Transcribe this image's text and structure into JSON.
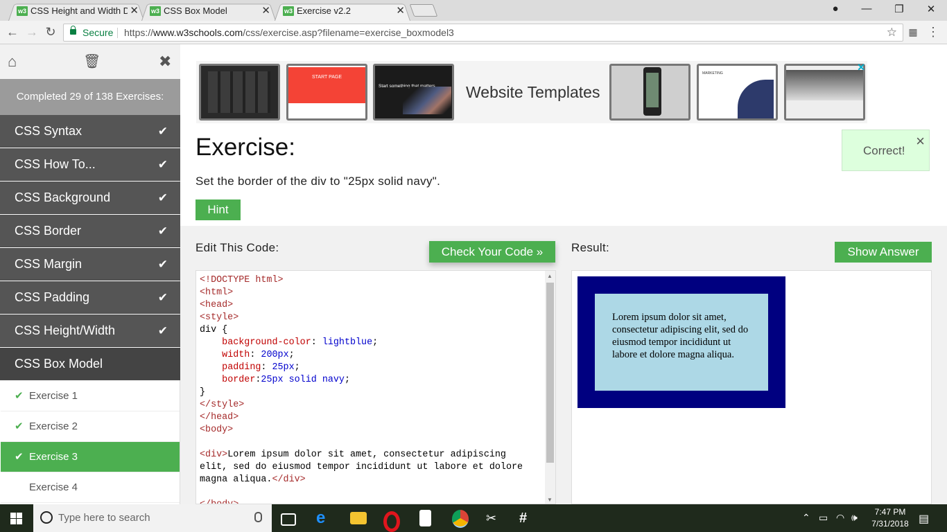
{
  "browser": {
    "tabs": [
      {
        "title": "CSS Height and Width Di",
        "active": false
      },
      {
        "title": "CSS Box Model",
        "active": false
      },
      {
        "title": "Exercise v2.2",
        "active": true
      }
    ],
    "secure_label": "Secure",
    "url_prefix": "https://",
    "url_host": "www.w3schools.com",
    "url_path": "/css/exercise.asp?filename=exercise_boxmodel3"
  },
  "sidebar": {
    "progress_text": "Completed 29 of 138 Exercises:",
    "chapters": [
      {
        "label": "CSS Syntax",
        "done": true
      },
      {
        "label": "CSS How To...",
        "done": true
      },
      {
        "label": "CSS Background",
        "done": true
      },
      {
        "label": "CSS Border",
        "done": true
      },
      {
        "label": "CSS Margin",
        "done": true
      },
      {
        "label": "CSS Padding",
        "done": true
      },
      {
        "label": "CSS Height/Width",
        "done": true
      },
      {
        "label": "CSS Box Model",
        "done": false
      }
    ],
    "exercises": [
      {
        "label": "Exercise 1",
        "done": true
      },
      {
        "label": "Exercise 2",
        "done": true
      },
      {
        "label": "Exercise 3",
        "done": true,
        "active": true
      },
      {
        "label": "Exercise 4",
        "done": false
      }
    ]
  },
  "ad": {
    "text": "Website Templates",
    "thumbs": [
      "dark-cafe",
      "start-page",
      "dark-gradient",
      "phone-hand",
      "marketing",
      "ocean-team"
    ],
    "thumb_start_page_label": "START PAGE",
    "thumb_dark_label": "Start something that matters",
    "thumb_marketing_label": "MARKETING"
  },
  "exercise": {
    "title": "Exercise:",
    "instruction": "Set the border of the div to \"25px solid navy\".",
    "hint_label": "Hint",
    "correct_label": "Correct!",
    "edit_label": "Edit This Code:",
    "check_label": "Check Your Code »",
    "result_label": "Result:",
    "show_answer_label": "Show Answer",
    "code_lines": [
      "<!DOCTYPE html>",
      "<html>",
      "<head>",
      "<style>",
      "div {",
      "    background-color: lightblue;",
      "    width: 200px;",
      "    padding: 25px;",
      "    border:25px solid navy;",
      "}",
      "</style>",
      "</head>",
      "<body>",
      "",
      "<div>Lorem ipsum dolor sit amet, consectetur adipiscing",
      "elit, sed do eiusmod tempor incididunt ut labore et dolore",
      "magna aliqua.</div>",
      "",
      "</body>"
    ],
    "result_text": "Lorem ipsum dolor sit amet, consectetur adipiscing elit, sed do eiusmod tempor incididunt ut labore et dolore magna aliqua."
  },
  "taskbar": {
    "search_placeholder": "Type here to search",
    "time": "7:47 PM",
    "date": "7/31/2018"
  },
  "colors": {
    "accent": "#4caf50",
    "sidebar_chapter": "#555555",
    "result_border": "#000080",
    "result_bg": "#add8e6"
  }
}
